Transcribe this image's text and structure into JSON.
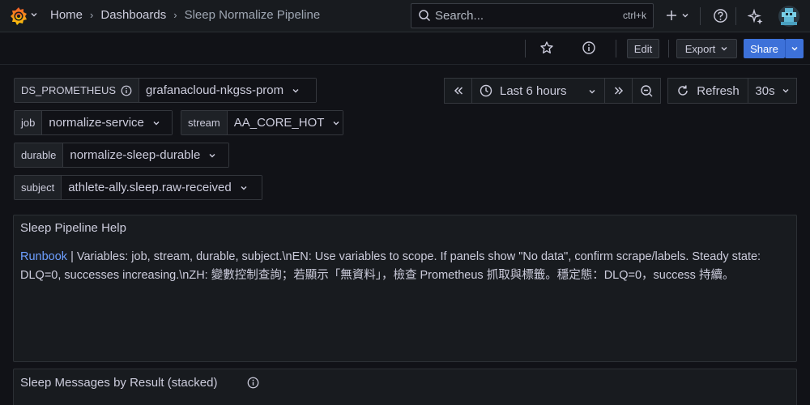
{
  "nav": {
    "breadcrumbs": [
      "Home",
      "Dashboards"
    ],
    "current": "Sleep Normalize Pipeline",
    "search_placeholder": "Search...",
    "search_shortcut": "ctrl+k"
  },
  "toolbar": {
    "edit_label": "Edit",
    "export_label": "Export",
    "share_label": "Share"
  },
  "variables": {
    "ds": {
      "label": "DS_PROMETHEUS",
      "value": "grafanacloud-nkgss-prom"
    },
    "job": {
      "label": "job",
      "value": "normalize-service"
    },
    "stream": {
      "label": "stream",
      "value": "AA_CORE_HOT"
    },
    "durable": {
      "label": "durable",
      "value": "normalize-sleep-durable"
    },
    "subject": {
      "label": "subject",
      "value": "athlete-ally.sleep.raw-received"
    }
  },
  "time": {
    "range": "Last 6 hours",
    "refresh_label": "Refresh",
    "interval": "30s"
  },
  "panels": {
    "help": {
      "title": "Sleep Pipeline Help",
      "link": "Runbook",
      "text": " | Variables: job, stream, durable, subject.\\nEN: Use variables to scope. If panels show \"No data\", confirm scrape/labels. Steady state: DLQ=0, successes increasing.\\nZH: 變數控制查詢；若顯示「無資料」，檢查 Prometheus 抓取與標籤。穩定態：DLQ=0，success 持續。"
    },
    "messages": {
      "title": "Sleep Messages by Result (stacked)"
    }
  },
  "colors": {
    "accent": "#3d71d9",
    "link": "#6e9fff",
    "logo_orange": "#f05a28",
    "logo_yellow": "#fbca0a"
  }
}
